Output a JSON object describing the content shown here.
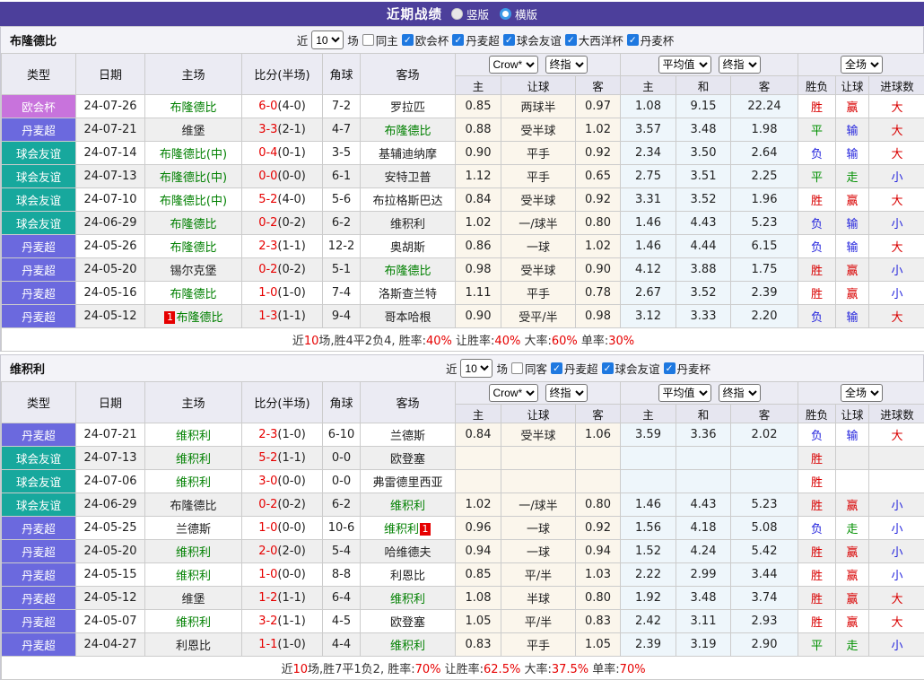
{
  "title_bar": {
    "title": "近期战绩",
    "view_options": [
      {
        "label": "竖版",
        "selected": false
      },
      {
        "label": "横版",
        "selected": true
      }
    ]
  },
  "columns": {
    "left": [
      "类型",
      "日期",
      "主场",
      "比分(半场)",
      "角球",
      "客场"
    ],
    "groups": [
      {
        "selects": [
          "Crow*",
          "终指"
        ],
        "sub": [
          "主",
          "让球",
          "客"
        ]
      },
      {
        "selects": [
          "平均值",
          "终指"
        ],
        "sub": [
          "主",
          "和",
          "客"
        ]
      },
      {
        "selects": [
          "全场"
        ],
        "sub": [
          "胜负",
          "让球",
          "进球数"
        ]
      }
    ]
  },
  "league_colors": {
    "欧会杯": "#c873dc",
    "丹麦超": "#6b69de",
    "球会友谊": "#17a89d"
  },
  "result_colors": {
    "r": "#d90000",
    "b": "#2525dd",
    "g": "#009000"
  },
  "tables": [
    {
      "team": "布隆德比",
      "filter": {
        "near_label": "近",
        "count": "10",
        "games_label": "场",
        "same": {
          "label": "同主",
          "checked": false
        },
        "leagues": [
          {
            "label": "欧会杯",
            "checked": true
          },
          {
            "label": "丹麦超",
            "checked": true
          },
          {
            "label": "球会友谊",
            "checked": true
          },
          {
            "label": "大西洋杯",
            "checked": true
          },
          {
            "label": "丹麦杯",
            "checked": true
          }
        ]
      },
      "rows": [
        {
          "league": "欧会杯",
          "date": "24-07-26",
          "home": "布隆德比",
          "home_green": true,
          "home_badge": "",
          "score": "6-0",
          "half": "(4-0)",
          "corners": "7-2",
          "away": "罗拉匹",
          "away_green": false,
          "away_badge": "",
          "odds": [
            "0.85",
            "两球半",
            "0.97",
            "1.08",
            "9.15",
            "22.24"
          ],
          "results": [
            [
              "胜",
              "r"
            ],
            [
              "赢",
              "r"
            ],
            [
              "大",
              "r"
            ]
          ]
        },
        {
          "league": "丹麦超",
          "date": "24-07-21",
          "home": "维堡",
          "home_green": false,
          "home_badge": "",
          "score": "3-3",
          "half": "(2-1)",
          "corners": "4-7",
          "away": "布隆德比",
          "away_green": true,
          "away_badge": "",
          "odds": [
            "0.88",
            "受半球",
            "1.02",
            "3.57",
            "3.48",
            "1.98"
          ],
          "results": [
            [
              "平",
              "g"
            ],
            [
              "输",
              "b"
            ],
            [
              "大",
              "r"
            ]
          ]
        },
        {
          "league": "球会友谊",
          "date": "24-07-14",
          "home": "布隆德比(中)",
          "home_green": true,
          "home_badge": "",
          "score": "0-4",
          "half": "(0-1)",
          "corners": "3-5",
          "away": "基辅迪纳摩",
          "away_green": false,
          "away_badge": "",
          "odds": [
            "0.90",
            "平手",
            "0.92",
            "2.34",
            "3.50",
            "2.64"
          ],
          "results": [
            [
              "负",
              "b"
            ],
            [
              "输",
              "b"
            ],
            [
              "大",
              "r"
            ]
          ]
        },
        {
          "league": "球会友谊",
          "date": "24-07-13",
          "home": "布隆德比(中)",
          "home_green": true,
          "home_badge": "",
          "score": "0-0",
          "half": "(0-0)",
          "corners": "6-1",
          "away": "安特卫普",
          "away_green": false,
          "away_badge": "",
          "odds": [
            "1.12",
            "平手",
            "0.65",
            "2.75",
            "3.51",
            "2.25"
          ],
          "results": [
            [
              "平",
              "g"
            ],
            [
              "走",
              "g"
            ],
            [
              "小",
              "b"
            ]
          ]
        },
        {
          "league": "球会友谊",
          "date": "24-07-10",
          "home": "布隆德比(中)",
          "home_green": true,
          "home_badge": "",
          "score": "5-2",
          "half": "(4-0)",
          "corners": "5-6",
          "away": "布拉格斯巴达",
          "away_green": false,
          "away_badge": "",
          "odds": [
            "0.84",
            "受半球",
            "0.92",
            "3.31",
            "3.52",
            "1.96"
          ],
          "results": [
            [
              "胜",
              "r"
            ],
            [
              "赢",
              "r"
            ],
            [
              "大",
              "r"
            ]
          ]
        },
        {
          "league": "球会友谊",
          "date": "24-06-29",
          "home": "布隆德比",
          "home_green": true,
          "home_badge": "",
          "score": "0-2",
          "half": "(0-2)",
          "corners": "6-2",
          "away": "维积利",
          "away_green": false,
          "away_badge": "",
          "odds": [
            "1.02",
            "一/球半",
            "0.80",
            "1.46",
            "4.43",
            "5.23"
          ],
          "results": [
            [
              "负",
              "b"
            ],
            [
              "输",
              "b"
            ],
            [
              "小",
              "b"
            ]
          ]
        },
        {
          "league": "丹麦超",
          "date": "24-05-26",
          "home": "布隆德比",
          "home_green": true,
          "home_badge": "",
          "score": "2-3",
          "half": "(1-1)",
          "corners": "12-2",
          "away": "奥胡斯",
          "away_green": false,
          "away_badge": "",
          "odds": [
            "0.86",
            "一球",
            "1.02",
            "1.46",
            "4.44",
            "6.15"
          ],
          "results": [
            [
              "负",
              "b"
            ],
            [
              "输",
              "b"
            ],
            [
              "大",
              "r"
            ]
          ]
        },
        {
          "league": "丹麦超",
          "date": "24-05-20",
          "home": "锡尔克堡",
          "home_green": false,
          "home_badge": "",
          "score": "0-2",
          "half": "(0-2)",
          "corners": "5-1",
          "away": "布隆德比",
          "away_green": true,
          "away_badge": "",
          "odds": [
            "0.98",
            "受半球",
            "0.90",
            "4.12",
            "3.88",
            "1.75"
          ],
          "results": [
            [
              "胜",
              "r"
            ],
            [
              "赢",
              "r"
            ],
            [
              "小",
              "b"
            ]
          ]
        },
        {
          "league": "丹麦超",
          "date": "24-05-16",
          "home": "布隆德比",
          "home_green": true,
          "home_badge": "",
          "score": "1-0",
          "half": "(1-0)",
          "corners": "7-4",
          "away": "洛斯查兰特",
          "away_green": false,
          "away_badge": "",
          "odds": [
            "1.11",
            "平手",
            "0.78",
            "2.67",
            "3.52",
            "2.39"
          ],
          "results": [
            [
              "胜",
              "r"
            ],
            [
              "赢",
              "r"
            ],
            [
              "小",
              "b"
            ]
          ]
        },
        {
          "league": "丹麦超",
          "date": "24-05-12",
          "home": "布隆德比",
          "home_green": true,
          "home_badge": "1",
          "score": "1-3",
          "half": "(1-1)",
          "corners": "9-4",
          "away": "哥本哈根",
          "away_green": false,
          "away_badge": "",
          "odds": [
            "0.90",
            "受平/半",
            "0.98",
            "3.12",
            "3.33",
            "2.20"
          ],
          "results": [
            [
              "负",
              "b"
            ],
            [
              "输",
              "b"
            ],
            [
              "大",
              "r"
            ]
          ]
        }
      ],
      "footer": [
        [
          "近",
          "d"
        ],
        [
          "10",
          "r"
        ],
        [
          "场,胜4平2负4, 胜率:",
          "d"
        ],
        [
          "40%",
          "r"
        ],
        [
          " 让胜率:",
          "d"
        ],
        [
          "40%",
          "r"
        ],
        [
          " 大率:",
          "d"
        ],
        [
          "60%",
          "r"
        ],
        [
          " 单率:",
          "d"
        ],
        [
          "30%",
          "r"
        ]
      ]
    },
    {
      "team": "维积利",
      "filter": {
        "near_label": "近",
        "count": "10",
        "games_label": "场",
        "same": {
          "label": "同客",
          "checked": false
        },
        "leagues": [
          {
            "label": "丹麦超",
            "checked": true
          },
          {
            "label": "球会友谊",
            "checked": true
          },
          {
            "label": "丹麦杯",
            "checked": true
          }
        ]
      },
      "rows": [
        {
          "league": "丹麦超",
          "date": "24-07-21",
          "home": "维积利",
          "home_green": true,
          "home_badge": "",
          "score": "2-3",
          "half": "(1-0)",
          "corners": "6-10",
          "away": "兰德斯",
          "away_green": false,
          "away_badge": "",
          "odds": [
            "0.84",
            "受半球",
            "1.06",
            "3.59",
            "3.36",
            "2.02"
          ],
          "results": [
            [
              "负",
              "b"
            ],
            [
              "输",
              "b"
            ],
            [
              "大",
              "r"
            ]
          ]
        },
        {
          "league": "球会友谊",
          "date": "24-07-13",
          "home": "维积利",
          "home_green": true,
          "home_badge": "",
          "score": "5-2",
          "half": "(1-1)",
          "corners": "0-0",
          "away": "欧登塞",
          "away_green": false,
          "away_badge": "",
          "odds": [
            "",
            "",
            "",
            "",
            "",
            ""
          ],
          "results": [
            [
              "胜",
              "r"
            ],
            [
              "",
              ""
            ],
            [
              "",
              ""
            ]
          ]
        },
        {
          "league": "球会友谊",
          "date": "24-07-06",
          "home": "维积利",
          "home_green": true,
          "home_badge": "",
          "score": "3-0",
          "half": "(0-0)",
          "corners": "0-0",
          "away": "弗雷德里西亚",
          "away_green": false,
          "away_badge": "",
          "odds": [
            "",
            "",
            "",
            "",
            "",
            ""
          ],
          "results": [
            [
              "胜",
              "r"
            ],
            [
              "",
              ""
            ],
            [
              "",
              ""
            ]
          ]
        },
        {
          "league": "球会友谊",
          "date": "24-06-29",
          "home": "布隆德比",
          "home_green": false,
          "home_badge": "",
          "score": "0-2",
          "half": "(0-2)",
          "corners": "6-2",
          "away": "维积利",
          "away_green": true,
          "away_badge": "",
          "odds": [
            "1.02",
            "一/球半",
            "0.80",
            "1.46",
            "4.43",
            "5.23"
          ],
          "results": [
            [
              "胜",
              "r"
            ],
            [
              "赢",
              "r"
            ],
            [
              "小",
              "b"
            ]
          ]
        },
        {
          "league": "丹麦超",
          "date": "24-05-25",
          "home": "兰德斯",
          "home_green": false,
          "home_badge": "",
          "score": "1-0",
          "half": "(0-0)",
          "corners": "10-6",
          "away": "维积利",
          "away_green": true,
          "away_badge": "1",
          "odds": [
            "0.96",
            "一球",
            "0.92",
            "1.56",
            "4.18",
            "5.08"
          ],
          "results": [
            [
              "负",
              "b"
            ],
            [
              "走",
              "g"
            ],
            [
              "小",
              "b"
            ]
          ]
        },
        {
          "league": "丹麦超",
          "date": "24-05-20",
          "home": "维积利",
          "home_green": true,
          "home_badge": "",
          "score": "2-0",
          "half": "(2-0)",
          "corners": "5-4",
          "away": "哈维德夫",
          "away_green": false,
          "away_badge": "",
          "odds": [
            "0.94",
            "一球",
            "0.94",
            "1.52",
            "4.24",
            "5.42"
          ],
          "results": [
            [
              "胜",
              "r"
            ],
            [
              "赢",
              "r"
            ],
            [
              "小",
              "b"
            ]
          ]
        },
        {
          "league": "丹麦超",
          "date": "24-05-15",
          "home": "维积利",
          "home_green": true,
          "home_badge": "",
          "score": "1-0",
          "half": "(0-0)",
          "corners": "8-8",
          "away": "利恩比",
          "away_green": false,
          "away_badge": "",
          "odds": [
            "0.85",
            "平/半",
            "1.03",
            "2.22",
            "2.99",
            "3.44"
          ],
          "results": [
            [
              "胜",
              "r"
            ],
            [
              "赢",
              "r"
            ],
            [
              "小",
              "b"
            ]
          ]
        },
        {
          "league": "丹麦超",
          "date": "24-05-12",
          "home": "维堡",
          "home_green": false,
          "home_badge": "",
          "score": "1-2",
          "half": "(1-1)",
          "corners": "6-4",
          "away": "维积利",
          "away_green": true,
          "away_badge": "",
          "odds": [
            "1.08",
            "半球",
            "0.80",
            "1.92",
            "3.48",
            "3.74"
          ],
          "results": [
            [
              "胜",
              "r"
            ],
            [
              "赢",
              "r"
            ],
            [
              "大",
              "r"
            ]
          ]
        },
        {
          "league": "丹麦超",
          "date": "24-05-07",
          "home": "维积利",
          "home_green": true,
          "home_badge": "",
          "score": "3-2",
          "half": "(1-1)",
          "corners": "4-5",
          "away": "欧登塞",
          "away_green": false,
          "away_badge": "",
          "odds": [
            "1.05",
            "平/半",
            "0.83",
            "2.42",
            "3.11",
            "2.93"
          ],
          "results": [
            [
              "胜",
              "r"
            ],
            [
              "赢",
              "r"
            ],
            [
              "大",
              "r"
            ]
          ]
        },
        {
          "league": "丹麦超",
          "date": "24-04-27",
          "home": "利恩比",
          "home_green": false,
          "home_badge": "",
          "score": "1-1",
          "half": "(1-0)",
          "corners": "4-4",
          "away": "维积利",
          "away_green": true,
          "away_badge": "",
          "odds": [
            "0.83",
            "平手",
            "1.05",
            "2.39",
            "3.19",
            "2.90"
          ],
          "results": [
            [
              "平",
              "g"
            ],
            [
              "走",
              "g"
            ],
            [
              "小",
              "b"
            ]
          ]
        }
      ],
      "footer": [
        [
          "近",
          "d"
        ],
        [
          "10",
          "r"
        ],
        [
          "场,胜7平1负2, 胜率:",
          "d"
        ],
        [
          "70%",
          "r"
        ],
        [
          " 让胜率:",
          "d"
        ],
        [
          "62.5%",
          "r"
        ],
        [
          " 大率:",
          "d"
        ],
        [
          "37.5%",
          "r"
        ],
        [
          " 单率:",
          "d"
        ],
        [
          "70%",
          "r"
        ]
      ]
    }
  ]
}
